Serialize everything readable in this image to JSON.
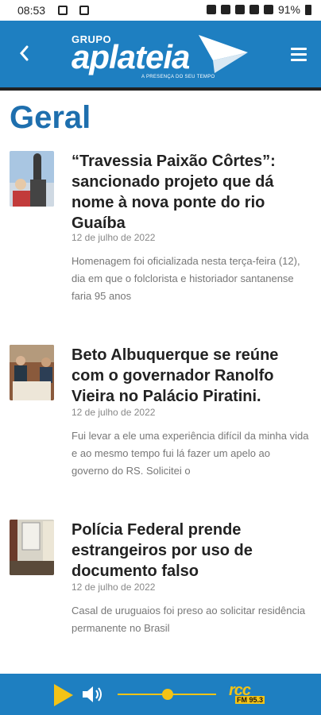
{
  "status_bar": {
    "time": "08:53",
    "battery": "91%"
  },
  "header": {
    "logo_top": "GRUPO",
    "logo_name": "aplateia",
    "logo_tagline": "A PRESENÇA DO SEU TEMPO",
    "brand_color": "#1e7fc1"
  },
  "page": {
    "title": "Geral"
  },
  "articles": [
    {
      "title": "“Travessia Paixão Côrtes”: sancionado projeto que dá nome à nova ponte do rio Guaíba",
      "date": "12 de julho de 2022",
      "summary": "Homenagem foi oficializada nesta terça-feira (12), dia em que o folclorista e historiador santanense faria 95 anos"
    },
    {
      "title": "Beto Albuquerque se reúne com o governador Ranolfo Vieira no Palácio Piratini.",
      "date": "12 de julho de 2022",
      "summary": "Fui levar a ele uma experiência difícil da minha vida e ao mesmo tempo fui lá fazer um apelo ao governo do RS. Solicitei o"
    },
    {
      "title": "Polícia Federal prende estrangeiros por uso de documento falso",
      "date": "12 de julho de 2022",
      "summary": "Casal de uruguaios foi preso ao solicitar residência permanente no Brasil"
    }
  ],
  "player": {
    "station_logo": "rcc",
    "station_freq": "FM 95.3",
    "volume_level": 0.45,
    "accent_color": "#f3c316"
  }
}
